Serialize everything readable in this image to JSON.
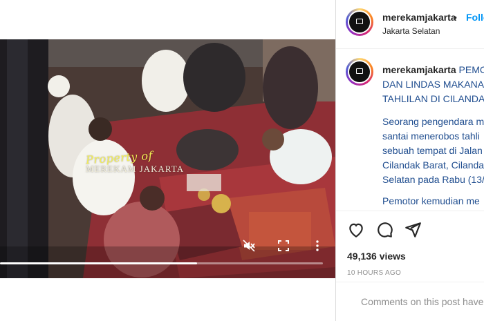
{
  "post": {
    "username": "merekamjakarta",
    "follow_label": "Follo",
    "separator": "•",
    "location": "Jakarta Selatan"
  },
  "video": {
    "watermark_script": "Property of",
    "watermark_caps": "MEREKAM JAKARTA",
    "progress": 0.61,
    "icons": [
      "mute-icon",
      "fullscreen-icon",
      "more-vertical-icon"
    ]
  },
  "caption": {
    "username": "merekamjakarta",
    "head_lines": [
      "PEMC",
      "DAN LINDAS MAKANA",
      "TAHLILAN DI CILANDA"
    ],
    "body_lines": [
      "Seorang pengendara m",
      "santai menerobos tahli",
      "sebuah tempat di Jalan",
      "Cilandak Barat, Cilanda",
      "Selatan pada Rabu (13/"
    ],
    "para2": "Pemotor kemudian me"
  },
  "actions": {
    "icons": [
      "heart-icon",
      "comment-icon",
      "share-icon"
    ],
    "views": "49,136 views",
    "time_ago": "10 HOURS AGO"
  },
  "comment": {
    "placeholder": "Comments on this post have"
  },
  "colors": {
    "link_blue": "#0095f6",
    "caption_blue": "#1f4d8f",
    "muted": "#8e8e8e"
  }
}
